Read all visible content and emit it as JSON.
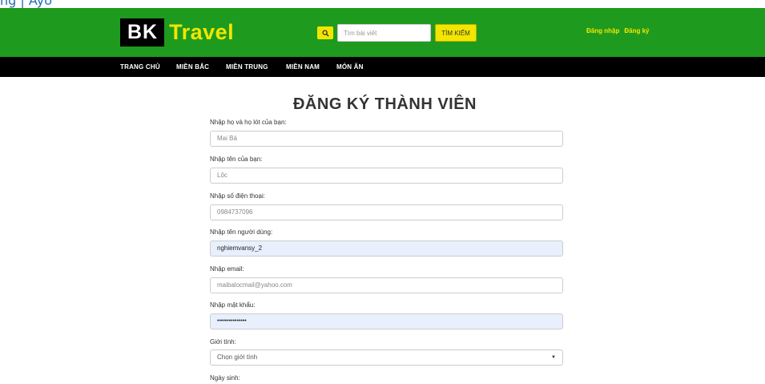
{
  "browser": {
    "partial_text": "ng | Ayo"
  },
  "header": {
    "logo_bk": "BK",
    "logo_travel": "Travel",
    "search_placeholder": "Tìm bài viết",
    "search_button": "TÌM KIẾM",
    "login": "Đăng nhập",
    "register": "Đăng ký",
    "colors": {
      "header_bg": "#1e9b1e",
      "accent": "#f2e600",
      "nav_bg": "#000000"
    }
  },
  "nav": {
    "items": [
      "TRANG CHỦ",
      "MIỀN BẮC",
      "MIỀN TRUNG",
      "MIỀN NAM",
      "MÓN ĂN"
    ]
  },
  "form": {
    "title": "ĐĂNG KÝ THÀNH VIÊN",
    "fields": [
      {
        "label": "Nhập họ và họ lót của bạn:",
        "value": "Mai Bá"
      },
      {
        "label": "Nhập tên của bạn:",
        "value": "Lộc"
      },
      {
        "label": "Nhập số điện thoại:",
        "value": "0984737096"
      },
      {
        "label": "Nhập tên người dùng:",
        "value": "nghiemvansy_2"
      },
      {
        "label": "Nhập email:",
        "value": "maibalocmail@yahoo.com"
      },
      {
        "label": "Nhập mật khẩu:",
        "value": "•••••••••••••••"
      },
      {
        "label": "Giới tính:",
        "value": "Chọn giới tính"
      }
    ],
    "last_label": "Ngày sinh:",
    "select_caret": "▼"
  }
}
